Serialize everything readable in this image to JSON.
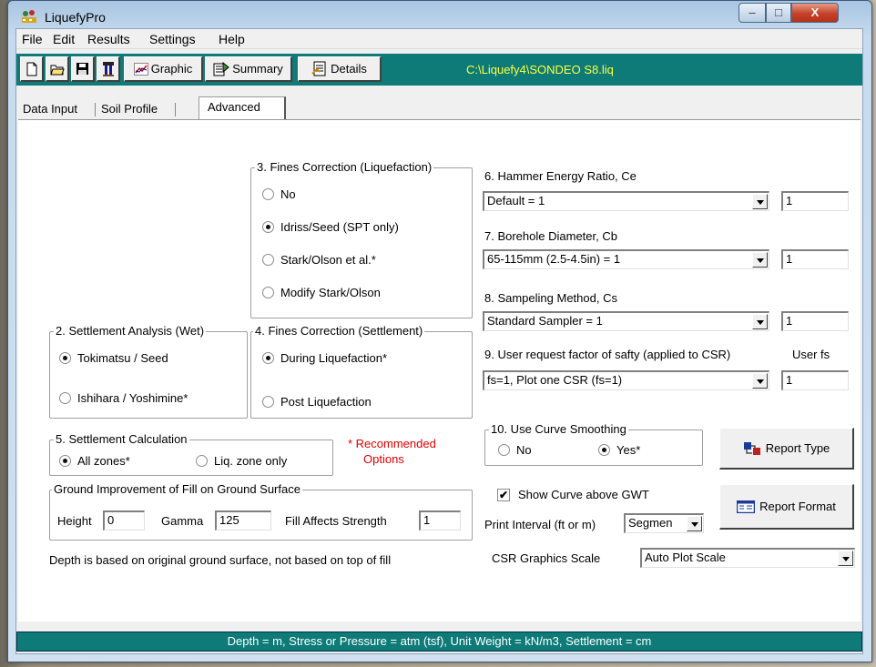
{
  "window": {
    "title": "LiquefyPro",
    "controls": {
      "minimize": "–",
      "maximize": "□",
      "close": "X"
    }
  },
  "menu": [
    "File",
    "Edit",
    "Results",
    "Settings",
    "Help"
  ],
  "toolbar": {
    "graphic": "Graphic",
    "summary": "Summary",
    "details": "Details",
    "file_path": "C:\\Liquefy4\\SONDEO S8.liq"
  },
  "tabs": [
    "Data Input",
    "Soil Profile",
    "Advanced"
  ],
  "fines_liq": {
    "legend": "3. Fines Correction (Liquefaction)",
    "options": [
      "No",
      "Idriss/Seed (SPT only)",
      "Stark/Olson et al.*",
      "Modify Stark/Olson"
    ],
    "selected": 1
  },
  "settlement_analysis": {
    "legend": "2. Settlement Analysis (Wet)",
    "options": [
      "Tokimatsu / Seed",
      "Ishihara / Yoshimine*"
    ],
    "selected": 0
  },
  "fines_settle": {
    "legend": "4. Fines Correction (Settlement)",
    "options": [
      "During Liquefaction*",
      "Post Liquefaction"
    ],
    "selected": 0
  },
  "settlement_calc": {
    "legend": "5. Settlement Calculation",
    "options": [
      "All zones*",
      "Liq. zone only"
    ],
    "selected": 0
  },
  "recommended": {
    "line1": "* Recommended",
    "line2": "Options",
    "color": "#e00000"
  },
  "ground_improvement": {
    "legend": "Ground Improvement of Fill on Ground Surface",
    "height_label": "Height",
    "height_value": "0",
    "gamma_label": "Gamma",
    "gamma_value": "125",
    "fill_label": "Fill Affects Strength",
    "fill_value": "1"
  },
  "depth_note": "Depth is based on original ground surface, not based on top of fill",
  "hammer": {
    "label": "6. Hammer Energy Ratio, Ce",
    "selected": "Default = 1",
    "value": "1"
  },
  "borehole": {
    "label": "7. Borehole Diameter, Cb",
    "selected": "65-115mm (2.5-4.5in) = 1",
    "value": "1"
  },
  "sampling": {
    "label": "8. Sampeling Method, Cs",
    "selected": "Standard Sampler = 1",
    "value": "1"
  },
  "user_fs": {
    "label": "9. User request factor of safty (applied to CSR)",
    "label2": "User fs",
    "selected": "fs=1,  Plot one CSR (fs=1)",
    "value": "1"
  },
  "smoothing": {
    "legend": "10. Use Curve Smoothing",
    "options": [
      "No",
      "Yes*"
    ],
    "selected": 1
  },
  "show_curve": {
    "label": "Show Curve above GWT",
    "checked": true
  },
  "print_interval": {
    "label": "Print Interval (ft or m)",
    "selected": "Segmen"
  },
  "csr_scale": {
    "label": "CSR Graphics Scale",
    "selected": "Auto Plot Scale"
  },
  "buttons": {
    "report_type": "Report Type",
    "report_format": "Report Format"
  },
  "status": "Depth = m, Stress or Pressure = atm (tsf), Unit Weight = kN/m3, Settlement = cm",
  "colors": {
    "toolbar_bg": "#0e7b78",
    "path_text": "#ffff40",
    "status_bg": "#0e7b78"
  }
}
